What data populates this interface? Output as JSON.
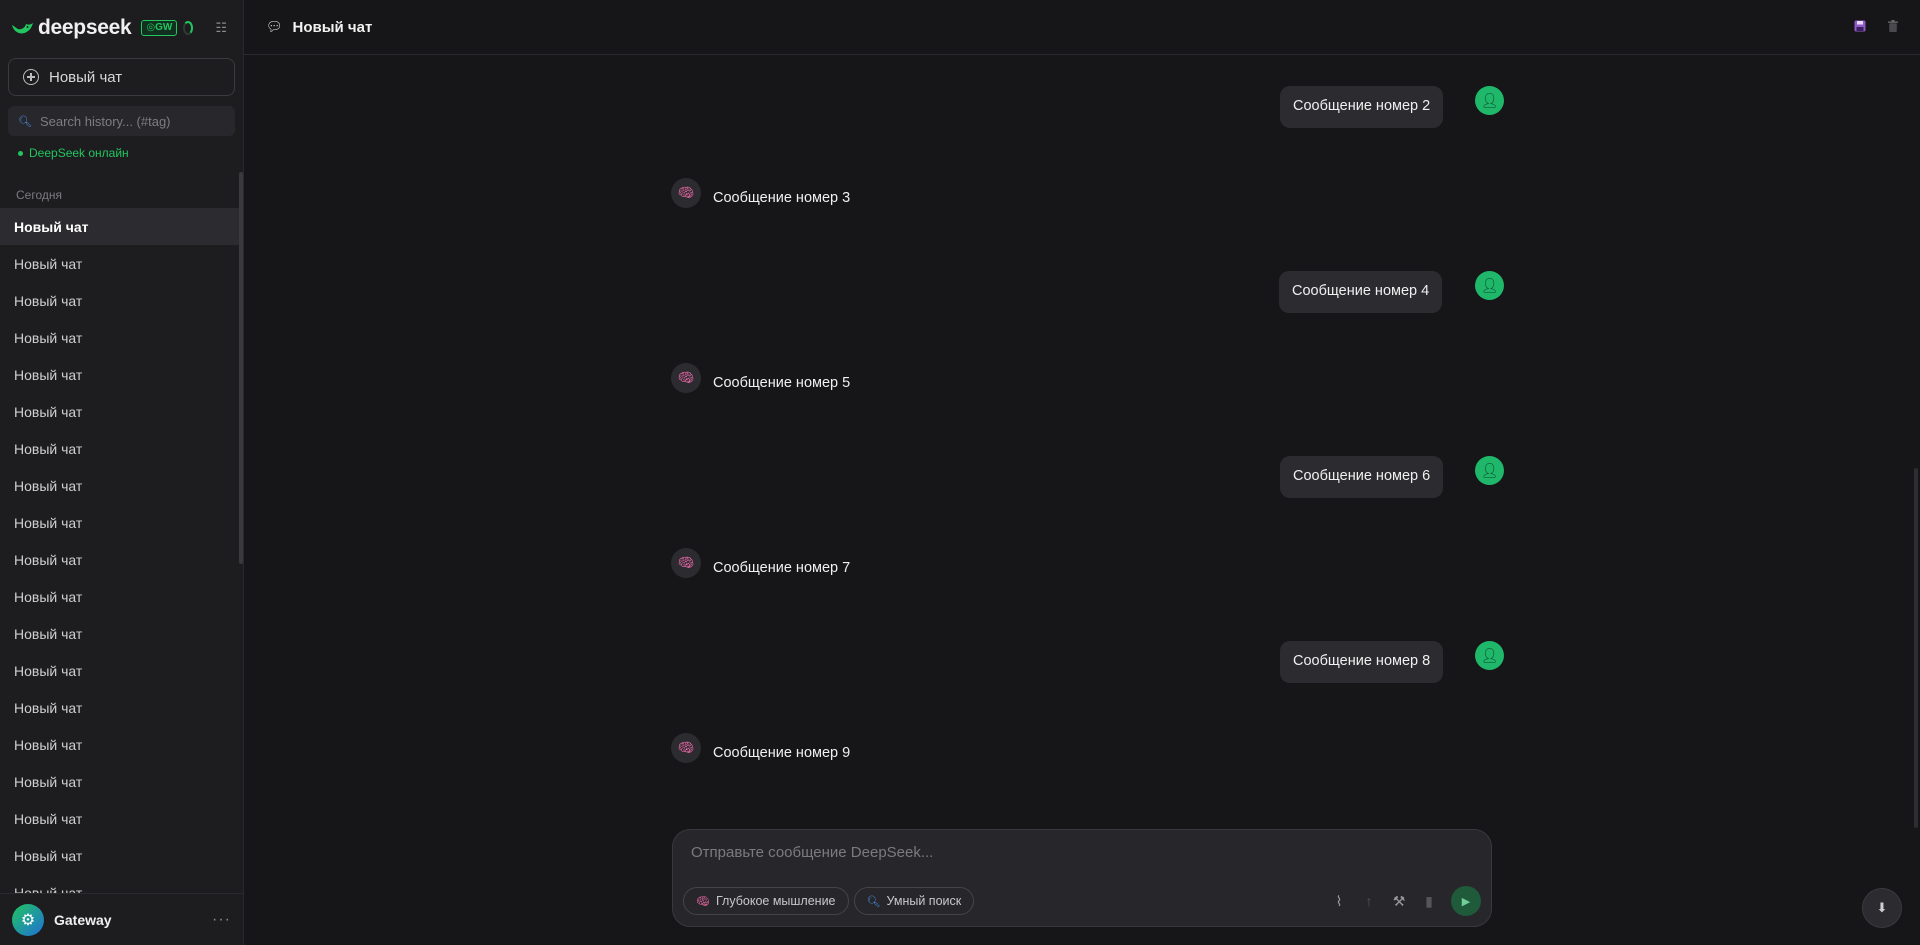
{
  "sidebar": {
    "brand": "deepseek",
    "badge": "GW",
    "new_chat_label": "Новый чат",
    "search_placeholder": "Search history... (#tag)",
    "status": "DeepSeek онлайн",
    "section_today": "Сегодня",
    "history": [
      "Новый чат",
      "Новый чат",
      "Новый чат",
      "Новый чат",
      "Новый чат",
      "Новый чат",
      "Новый чат",
      "Новый чат",
      "Новый чат",
      "Новый чат",
      "Новый чат",
      "Новый чат",
      "Новый чат",
      "Новый чат",
      "Новый чат",
      "Новый чат",
      "Новый чат",
      "Новый чат",
      "Новый чат"
    ],
    "user_name": "Gateway"
  },
  "header": {
    "title": "Новый чат"
  },
  "messages": [
    {
      "role": "user",
      "text": "Сообщение номер 2"
    },
    {
      "role": "assistant",
      "text": "Сообщение номер 3"
    },
    {
      "role": "user",
      "text": "Сообщение номер 4"
    },
    {
      "role": "assistant",
      "text": "Сообщение номер 5"
    },
    {
      "role": "user",
      "text": "Сообщение номер 6"
    },
    {
      "role": "assistant",
      "text": "Сообщение номер 7"
    },
    {
      "role": "user",
      "text": "Сообщение номер 8"
    },
    {
      "role": "assistant",
      "text": "Сообщение номер 9"
    }
  ],
  "composer": {
    "placeholder": "Отправьте сообщение DeepSeek...",
    "value": "",
    "chip_deep_thinking": "Глубокое мышление",
    "chip_smart_search": "Умный поиск"
  },
  "colors": {
    "accent": "#22c55e",
    "background": "#161618",
    "sidebar": "#1d1d20",
    "bubble": "#2c2c30"
  },
  "icons": {
    "logo": "whale-icon",
    "header_chat": "speech-bubble-icon",
    "header_save": "floppy-disk-icon",
    "header_delete": "trash-icon",
    "assistant_avatar": "brain-icon",
    "user_avatar": "person-icon"
  }
}
